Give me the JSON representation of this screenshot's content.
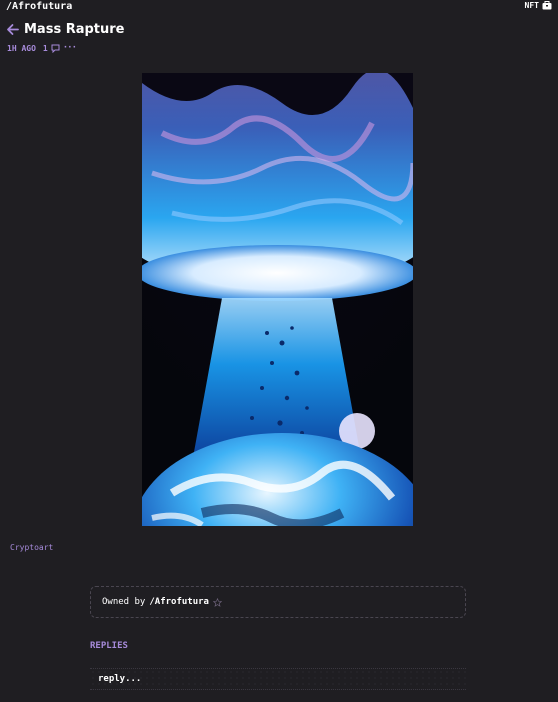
{
  "header": {
    "handle": "/Afrofutura",
    "badge": "NFT"
  },
  "post": {
    "title": "Mass Rapture",
    "time": "1H AGO",
    "comment_count": "1",
    "more": "···",
    "tag": "Cryptoart",
    "artwork_alt": "Mass Rapture artwork"
  },
  "ownership": {
    "label": "Owned by",
    "owner": "/Afrofutura"
  },
  "replies": {
    "heading": "REPLIES",
    "placeholder": "reply..."
  },
  "colors": {
    "background": "#1f1e22",
    "accent": "#a78bdb",
    "border": "#4a4650"
  },
  "icons": [
    "wallet-icon",
    "back-arrow-icon",
    "comment-icon",
    "more-icon",
    "star-icon"
  ]
}
